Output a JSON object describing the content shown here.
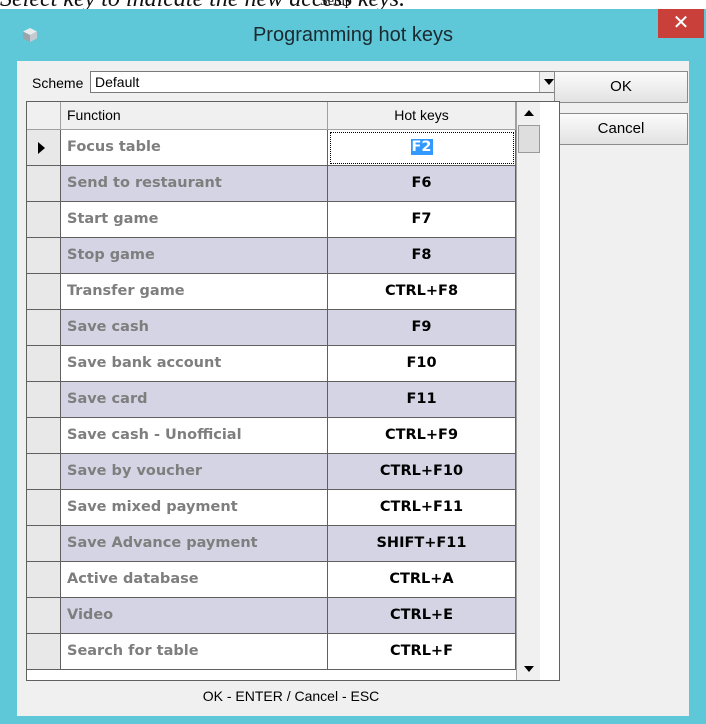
{
  "background": {
    "text": "Select key to indicate the new access keys.",
    "subtext": "Setup"
  },
  "window": {
    "title": "Programming hot keys",
    "close_glyph": "✕",
    "accent_color": "#5fc8d8"
  },
  "scheme": {
    "label": "Scheme",
    "value": "Default"
  },
  "buttons": {
    "ok": "OK",
    "cancel": "Cancel"
  },
  "table": {
    "columns": [
      "Function",
      "Hot keys"
    ],
    "current_row": 0,
    "rows": [
      {
        "function": "Focus table",
        "hotkey": "F2"
      },
      {
        "function": "Send to restaurant",
        "hotkey": "F6"
      },
      {
        "function": "Start game",
        "hotkey": "F7"
      },
      {
        "function": "Stop game",
        "hotkey": "F8"
      },
      {
        "function": "Transfer game",
        "hotkey": "CTRL+F8"
      },
      {
        "function": "Save cash",
        "hotkey": "F9"
      },
      {
        "function": "Save bank account",
        "hotkey": "F10"
      },
      {
        "function": "Save card",
        "hotkey": "F11"
      },
      {
        "function": "Save cash - Unofficial",
        "hotkey": "CTRL+F9"
      },
      {
        "function": "Save by voucher",
        "hotkey": "CTRL+F10"
      },
      {
        "function": "Save mixed payment",
        "hotkey": "CTRL+F11"
      },
      {
        "function": "Save Advance payment",
        "hotkey": "SHIFT+F11"
      },
      {
        "function": "Active database",
        "hotkey": "CTRL+A"
      },
      {
        "function": "Video",
        "hotkey": "CTRL+E"
      },
      {
        "function": "Search for table",
        "hotkey": "CTRL+F"
      }
    ]
  },
  "status": "OK - ENTER / Cancel - ESC"
}
